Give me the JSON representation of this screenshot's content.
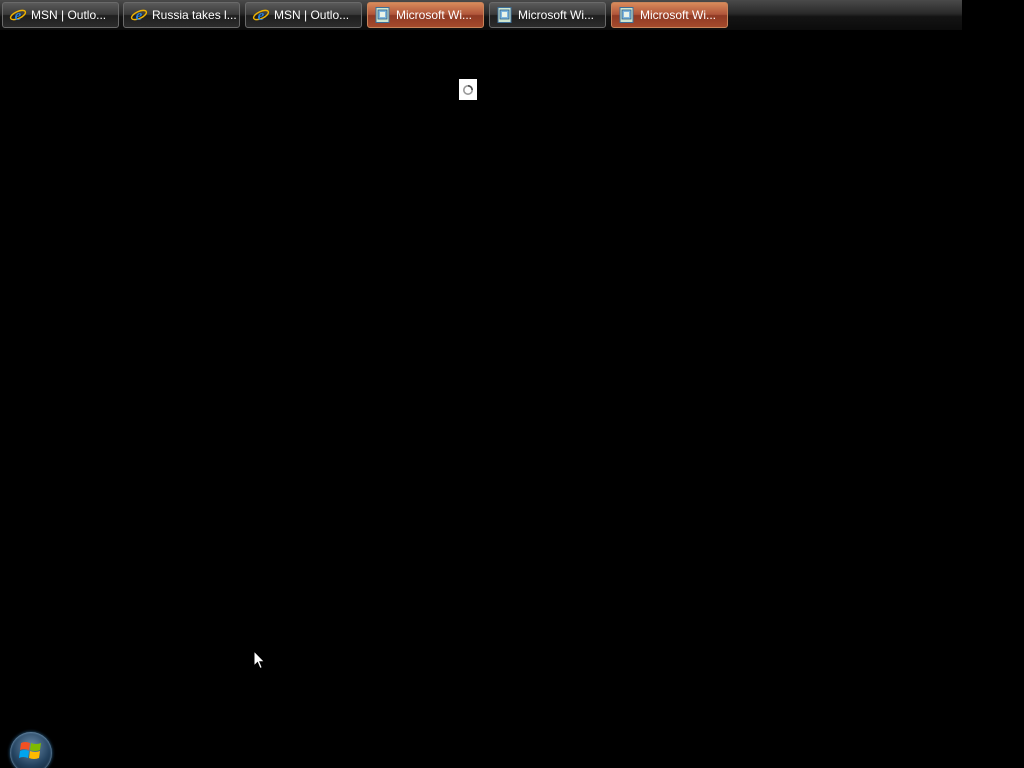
{
  "taskbar": {
    "buttons": [
      {
        "label": "MSN | Outlo...",
        "icon": "internet-explorer-icon",
        "flashing": false
      },
      {
        "label": "Russia takes l...",
        "icon": "internet-explorer-icon",
        "flashing": false
      },
      {
        "label": "MSN | Outlo...",
        "icon": "internet-explorer-icon",
        "flashing": false
      },
      {
        "label": "Microsoft Wi...",
        "icon": "application-window-icon",
        "flashing": true
      },
      {
        "label": "Microsoft Wi...",
        "icon": "application-window-icon",
        "flashing": false
      },
      {
        "label": "Microsoft Wi...",
        "icon": "application-window-icon",
        "flashing": true
      }
    ]
  },
  "colors": {
    "desktop_background": "#000000",
    "flash_accent": "#b0553a",
    "ie_blue": "#2a7fd4",
    "ie_ring": "#f0b400"
  },
  "start_button": {
    "icon": "windows-logo-icon"
  },
  "spinner": {
    "icon": "loading-spinner-icon"
  },
  "cursor": {
    "icon": "mouse-pointer-icon"
  }
}
